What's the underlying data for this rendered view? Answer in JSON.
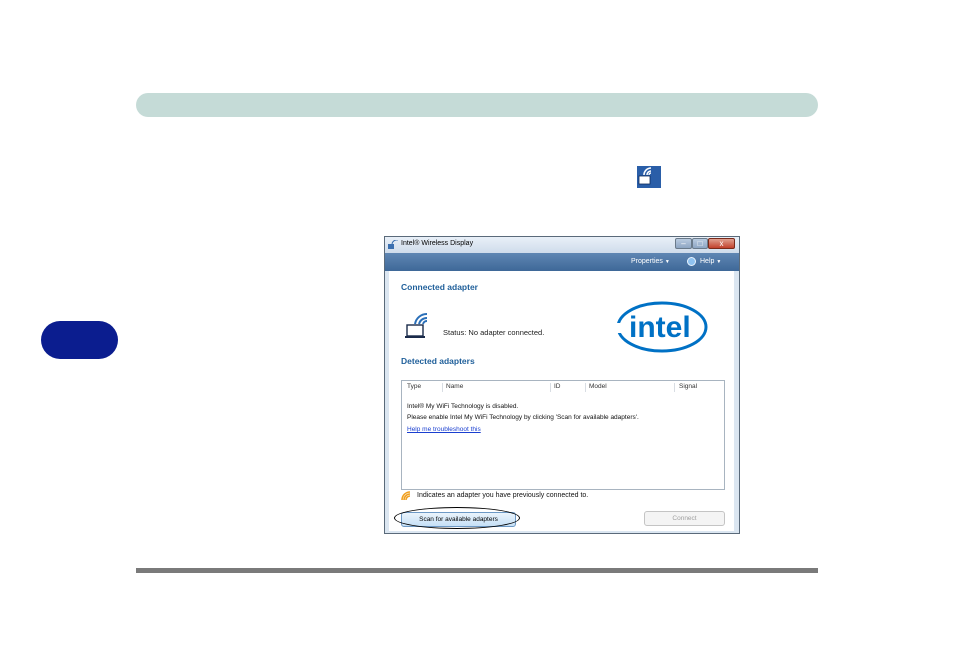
{
  "window": {
    "title": "Intel® Wireless Display",
    "minimize_glyph": "–",
    "maximize_glyph": "□",
    "close_glyph": "x"
  },
  "toolbar": {
    "properties_label": "Properties",
    "help_label": "Help",
    "menu_arrow": "▼"
  },
  "connected_section": {
    "title": "Connected adapter",
    "status_text": "Status: No adapter connected."
  },
  "brand": {
    "logo_text": "intel",
    "logo_color": "#0071c5"
  },
  "detected_section": {
    "title": "Detected adapters",
    "columns": [
      "Type",
      "Name",
      "ID",
      "Model",
      "Signal"
    ],
    "message_line_1": "Intel® My WiFi Technology is disabled.",
    "message_line_2": "Please enable Intel My WiFi Technology by clicking 'Scan for available adapters'.",
    "help_link": "Help me troubleshoot this"
  },
  "legend_text": "Indicates an adapter you have previously connected to.",
  "buttons": {
    "scan": "Scan for available adapters",
    "connect": "Connect"
  },
  "colors": {
    "header_bar": "#c5dbd7",
    "chapter_tab": "#0b1d8f",
    "accent_title": "#1f5f9a",
    "toolbar": "#4a73a3"
  }
}
